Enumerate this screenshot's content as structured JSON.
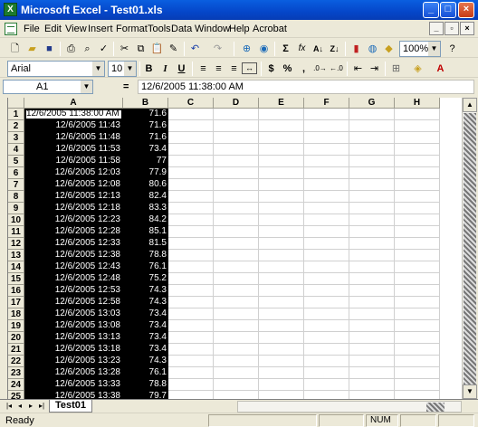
{
  "window": {
    "title": "Microsoft Excel - Test01.xls",
    "controls": {
      "minimize": "_",
      "maximize": "□",
      "close": "×"
    }
  },
  "menu": {
    "items": [
      "File",
      "Edit",
      "View",
      "Insert",
      "Format",
      "Tools",
      "Data",
      "Window",
      "Help",
      "Acrobat"
    ],
    "doc_controls": {
      "minimize": "_",
      "restore": "▫",
      "close": "×"
    }
  },
  "standard_toolbar": {
    "zoom": "100%",
    "icons": [
      "new-icon",
      "open-icon",
      "save-icon",
      "print-icon",
      "print-preview-icon",
      "spelling-icon",
      "cut-icon",
      "copy-icon",
      "paste-icon",
      "format-painter-icon",
      "undo-icon",
      "redo-icon",
      "hyperlink-icon",
      "web-icon",
      "autosum-icon",
      "function-icon",
      "sort-ascending-icon",
      "sort-descending-icon",
      "chart-wizard-icon",
      "map-icon",
      "drawing-icon",
      "help-icon"
    ],
    "glyphs": {
      "autosum": "Σ",
      "function": "fx",
      "sort_asc": "A↓",
      "sort_desc": "Z↓"
    }
  },
  "formatting_toolbar": {
    "font": "Arial",
    "size": "10",
    "bold": "B",
    "italic": "I",
    "underline": "U",
    "currency": "$",
    "percent": "%",
    "comma": ","
  },
  "formula_bar": {
    "name_box": "A1",
    "equals": "=",
    "content": "12/6/2005  11:38:00 AM"
  },
  "grid": {
    "columns": [
      "A",
      "B",
      "C",
      "D",
      "E",
      "F",
      "G",
      "H"
    ],
    "rows": [
      {
        "n": "1",
        "a": "12/6/2005  11:38:00 AM",
        "b": "71.6"
      },
      {
        "n": "2",
        "a": "12/6/2005 11:43",
        "b": "71.6"
      },
      {
        "n": "3",
        "a": "12/6/2005 11:48",
        "b": "71.6"
      },
      {
        "n": "4",
        "a": "12/6/2005 11:53",
        "b": "73.4"
      },
      {
        "n": "5",
        "a": "12/6/2005 11:58",
        "b": "77"
      },
      {
        "n": "6",
        "a": "12/6/2005 12:03",
        "b": "77.9"
      },
      {
        "n": "7",
        "a": "12/6/2005 12:08",
        "b": "80.6"
      },
      {
        "n": "8",
        "a": "12/6/2005 12:13",
        "b": "82.4"
      },
      {
        "n": "9",
        "a": "12/6/2005 12:18",
        "b": "83.3"
      },
      {
        "n": "10",
        "a": "12/6/2005 12:23",
        "b": "84.2"
      },
      {
        "n": "11",
        "a": "12/6/2005 12:28",
        "b": "85.1"
      },
      {
        "n": "12",
        "a": "12/6/2005 12:33",
        "b": "81.5"
      },
      {
        "n": "13",
        "a": "12/6/2005 12:38",
        "b": "78.8"
      },
      {
        "n": "14",
        "a": "12/6/2005 12:43",
        "b": "76.1"
      },
      {
        "n": "15",
        "a": "12/6/2005 12:48",
        "b": "75.2"
      },
      {
        "n": "16",
        "a": "12/6/2005 12:53",
        "b": "74.3"
      },
      {
        "n": "17",
        "a": "12/6/2005 12:58",
        "b": "74.3"
      },
      {
        "n": "18",
        "a": "12/6/2005 13:03",
        "b": "73.4"
      },
      {
        "n": "19",
        "a": "12/6/2005 13:08",
        "b": "73.4"
      },
      {
        "n": "20",
        "a": "12/6/2005 13:13",
        "b": "73.4"
      },
      {
        "n": "21",
        "a": "12/6/2005 13:18",
        "b": "73.4"
      },
      {
        "n": "22",
        "a": "12/6/2005 13:23",
        "b": "74.3"
      },
      {
        "n": "23",
        "a": "12/6/2005 13:28",
        "b": "76.1"
      },
      {
        "n": "24",
        "a": "12/6/2005 13:33",
        "b": "78.8"
      },
      {
        "n": "25",
        "a": "12/6/2005 13:38",
        "b": "79.7"
      }
    ]
  },
  "sheet_tabs": [
    "Test01"
  ],
  "status": {
    "text": "Ready",
    "num": "NUM"
  }
}
